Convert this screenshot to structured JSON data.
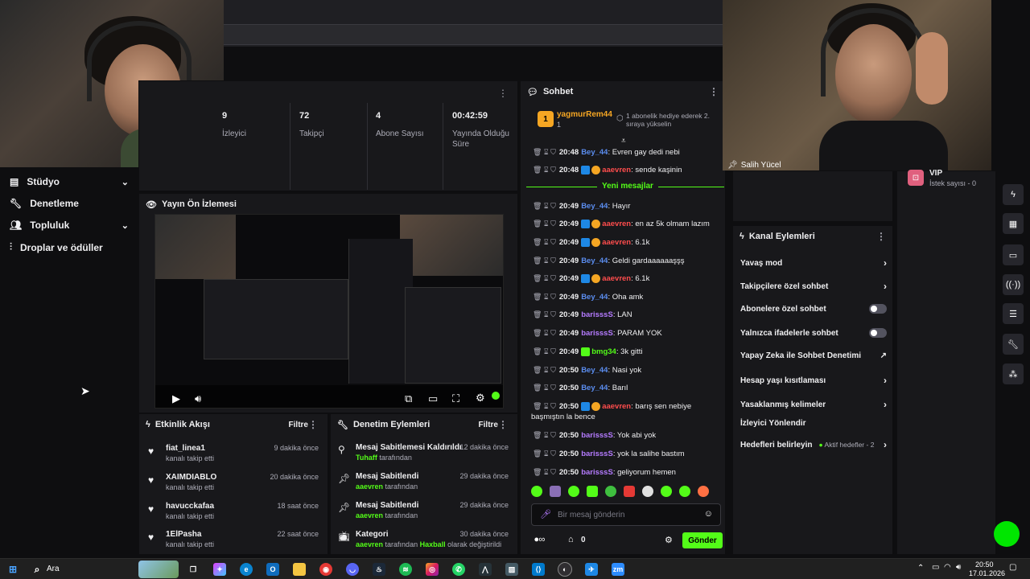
{
  "nav": {
    "items": [
      {
        "label": "Stüdyo",
        "has_chevron": true
      },
      {
        "label": "Denetleme",
        "has_chevron": false
      },
      {
        "label": "Topluluk",
        "has_chevron": true
      },
      {
        "label": "Droplar ve ödüller",
        "has_chevron": false
      }
    ]
  },
  "stats": [
    {
      "value": "9",
      "label": "İzleyici"
    },
    {
      "value": "72",
      "label": "Takipçi"
    },
    {
      "value": "4",
      "label": "Abone Sayısı"
    },
    {
      "value": "00:42:59",
      "label": "Yayında Olduğu Süre"
    }
  ],
  "preview": {
    "title": "Yayın Ön İzlemesi"
  },
  "activity": {
    "title": "Etkinlik Akışı",
    "filter": "Filtre",
    "items": [
      {
        "name": "fiat_linea1",
        "action": "kanalı takip etti",
        "time": "9 dakika önce"
      },
      {
        "name": "XAIMDIABLO",
        "action": "kanalı takip etti",
        "time": "20 dakika önce"
      },
      {
        "name": "havucckafaa",
        "action": "kanalı takip etti",
        "time": "18 saat önce"
      },
      {
        "name": "1ElPasha",
        "action": "kanalı takip etti",
        "time": "22 saat önce"
      }
    ]
  },
  "moderation": {
    "title": "Denetim Eylemleri",
    "filter": "Filtre",
    "items": [
      {
        "name": "Mesaj Sabitlemesi Kaldırıldı",
        "by": "Tuhaff",
        "suffix": "tarafından",
        "extra": "",
        "time": "12 dakika önce",
        "icon": "unpin-icon"
      },
      {
        "name": "Mesaj Sabitlendi",
        "by": "aaevren",
        "suffix": "tarafından",
        "extra": "",
        "time": "29 dakika önce",
        "icon": "pin-icon"
      },
      {
        "name": "Mesaj Sabitlendi",
        "by": "aaevren",
        "suffix": "tarafından",
        "extra": "",
        "time": "29 dakika önce",
        "icon": "pin-icon"
      },
      {
        "name": "Kategori",
        "by": "aaevren",
        "suffix": "tarafından",
        "extra_user": "Haxball",
        "extra": "olarak değiştirildi",
        "time": "30 dakika önce",
        "icon": "tv-icon"
      }
    ]
  },
  "chat": {
    "title": "Sohbet",
    "gift": {
      "user": "yagmurRem44",
      "count": "1",
      "text": "1 abonelik hediye ederek 2. sıraya yükselin"
    },
    "new_messages": "Yeni mesajlar",
    "messages": [
      {
        "time": "20:48",
        "user": "Bey_44",
        "color": "#5b8def",
        "badges": [],
        "text": ": Evren gay dedi nebi"
      },
      {
        "time": "20:48",
        "user": "aaevren",
        "color": "#ff4d4d",
        "badges": [
          "blue",
          "gold"
        ],
        "text": ": sende kaşinin"
      },
      {
        "time": "20:49",
        "user": "Bey_44",
        "color": "#5b8def",
        "badges": [],
        "text": ": Hayır"
      },
      {
        "time": "20:49",
        "user": "aaevren",
        "color": "#ff4d4d",
        "badges": [
          "blue",
          "gold"
        ],
        "text": ": en az 5k olmam lazım"
      },
      {
        "time": "20:49",
        "user": "aaevren",
        "color": "#ff4d4d",
        "badges": [
          "blue",
          "gold"
        ],
        "text": ": 6.1k"
      },
      {
        "time": "20:49",
        "user": "Bey_44",
        "color": "#5b8def",
        "badges": [],
        "text": ": Geldi gardaaaaaaşşş"
      },
      {
        "time": "20:49",
        "user": "aaevren",
        "color": "#ff4d4d",
        "badges": [
          "blue",
          "gold"
        ],
        "text": ": 6.1k"
      },
      {
        "time": "20:49",
        "user": "Bey_44",
        "color": "#5b8def",
        "badges": [],
        "text": ": Oha amk"
      },
      {
        "time": "20:49",
        "user": "barisssS",
        "color": "#b57bff",
        "badges": [],
        "text": ": LAN"
      },
      {
        "time": "20:49",
        "user": "barisssS",
        "color": "#b57bff",
        "badges": [],
        "text": ": PARAM YOK"
      },
      {
        "time": "20:49",
        "user": "bmg34",
        "color": "#53fc18",
        "badges": [
          "green"
        ],
        "text": ": 3k gitti"
      },
      {
        "time": "20:50",
        "user": "Bey_44",
        "color": "#5b8def",
        "badges": [],
        "text": ": Nasi yok"
      },
      {
        "time": "20:50",
        "user": "Bey_44",
        "color": "#5b8def",
        "badges": [],
        "text": ": Barıl"
      },
      {
        "time": "20:50",
        "user": "aaevren",
        "color": "#ff4d4d",
        "badges": [
          "blue",
          "gold"
        ],
        "text": ": barış sen nebiye",
        "cont": "başmıştın la bence"
      },
      {
        "time": "20:50",
        "user": "barisssS",
        "color": "#b57bff",
        "badges": [],
        "text": ": Yok abi yok"
      },
      {
        "time": "20:50",
        "user": "barisssS",
        "color": "#b57bff",
        "badges": [],
        "text": ": yok la salihe bastım"
      },
      {
        "time": "20:50",
        "user": "barisssS",
        "color": "#b57bff",
        "badges": [],
        "text": ": geliyorum hemen"
      }
    ],
    "input_placeholder": "Bir mesaj gönderin",
    "points": "0",
    "send_label": "Gönder"
  },
  "webcam_right": {
    "name": "Salih Yücel"
  },
  "vip": {
    "title": "VIP",
    "subtitle": "İstek sayısı - 0"
  },
  "channel_actions": {
    "title": "Kanal Eylemleri",
    "items": [
      {
        "label": "Yavaş mod",
        "control": "chevron"
      },
      {
        "label": "Takipçilere özel sohbet",
        "control": "chevron"
      },
      {
        "label": "Abonelere özel sohbet",
        "control": "toggle"
      },
      {
        "label": "Yalnızca ifadelerle sohbet",
        "control": "toggle"
      },
      {
        "label": "Yapay Zeka ile Sohbet Denetimi",
        "control": "external"
      },
      {
        "label": "Hesap yaşı kısıtlaması",
        "control": "chevron"
      },
      {
        "label": "Yasaklanmış kelimeler",
        "control": "chevron"
      },
      {
        "label": "İzleyici Yönlendir",
        "control": "none"
      },
      {
        "label": "Hedefleri belirleyin",
        "control": "chevron",
        "status": "Aktif hedefler - 2"
      }
    ]
  },
  "taskbar": {
    "search_label": "Ara",
    "time": "20:50",
    "date": "17.01.2026"
  },
  "colors": {
    "accent": "#53fc18",
    "bg": "#0e0e10",
    "panel": "#18181b"
  }
}
